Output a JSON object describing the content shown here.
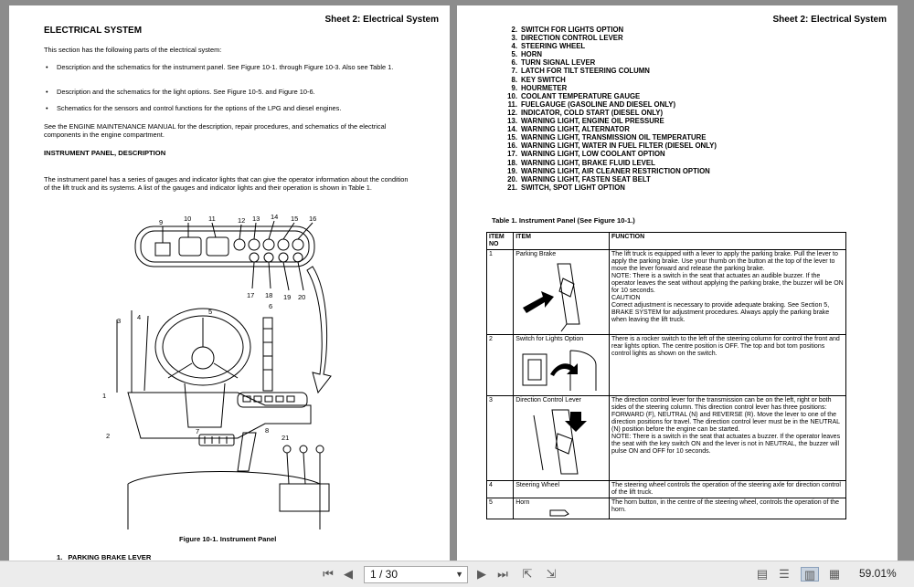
{
  "left_page": {
    "sheet_header": "Sheet 2: Electrical System",
    "title": "ELECTRICAL SYSTEM",
    "intro": "This section has the following parts of the electrical system:",
    "bullets": [
      "Description and the schematics for the instrument  panel.  See  Figure 10-1.  through Figure 10-3. Also see Table 1.",
      "Description and the schematics for the light options. See Figure 10-5. and Figure 10-6.",
      "Schematics for the sensors and control functions for the options of the LPG and diesel engines."
    ],
    "see_manual": "See the ENGINE MAINTENANCE MANUAL for the description, repair procedures, and schematics of the electrical components in the engine compartment.",
    "subheading": "INSTRUMENT PANEL, DESCRIPTION",
    "description": "The instrument panel has a series of gauges and indicator lights that can give the operator information about the condition of the lift truck and its systems. A list of the gauges and indicator lights and their operation is shown in Table 1.",
    "figure": {
      "labels_top": [
        "9",
        "10",
        "11",
        "12",
        "13",
        "14",
        "15",
        "16"
      ],
      "labels_bottom": [
        "17",
        "18",
        "19",
        "20"
      ],
      "labels_body": [
        "1",
        "2",
        "3",
        "4",
        "5",
        "6",
        "7",
        "8",
        "21"
      ],
      "caption": "Figure 10-1. Instrument Panel"
    },
    "bottom_heading_num": "1.",
    "bottom_heading": "PARKING BRAKE LEVER"
  },
  "right_page": {
    "sheet_header": "Sheet 2: Electrical System",
    "list": [
      {
        "n": "2.",
        "t": "SWITCH FOR LIGHTS OPTION"
      },
      {
        "n": "3.",
        "t": "DIRECTION CONTROL LEVER"
      },
      {
        "n": "4.",
        "t": "STEERING WHEEL"
      },
      {
        "n": "5.",
        "t": "HORN"
      },
      {
        "n": "6.",
        "t": "TURN SIGNAL LEVER"
      },
      {
        "n": "7.",
        "t": "LATCH FOR TILT STEERING COLUMN"
      },
      {
        "n": "8.",
        "t": "KEY SWITCH"
      },
      {
        "n": "9.",
        "t": "HOURMETER"
      },
      {
        "n": "10.",
        "t": "COOLANT TEMPERATURE GAUGE"
      },
      {
        "n": "11.",
        "t": "FUELGAUGE (GASOLINE AND DIESEL ONLY)"
      },
      {
        "n": "12.",
        "t": "INDICATOR, COLD START (DIESEL ONLY)"
      },
      {
        "n": "13.",
        "t": "WARNING LIGHT, ENGINE OIL PRESSURE"
      },
      {
        "n": "14.",
        "t": "WARNING LIGHT, ALTERNATOR"
      },
      {
        "n": "15.",
        "t": "WARNING LIGHT, TRANSMISSION OIL TEMPERATURE"
      },
      {
        "n": "16.",
        "t": "WARNING LIGHT, WATER IN FUEL FILTER (DIESEL ONLY)"
      },
      {
        "n": "17.",
        "t": "WARNING LIGHT, LOW COOLANT OPTION"
      },
      {
        "n": "18.",
        "t": "WARNING LIGHT, BRAKE FLUID LEVEL"
      },
      {
        "n": "19.",
        "t": "WARNING LIGHT, AIR CLEANER RESTRICTION OPTION"
      },
      {
        "n": "20.",
        "t": "WARNING LIGHT, FASTEN SEAT BELT"
      },
      {
        "n": "21.",
        "t": "SWITCH, SPOT LIGHT OPTION"
      }
    ],
    "table_caption": "Table 1. Instrument Panel (See Figure 10-1.)",
    "table": {
      "headers": [
        "ITEM NO",
        "ITEM",
        "FUNCTION"
      ],
      "rows": [
        {
          "no": "1",
          "item": "Parking Brake",
          "func": "The lift truck is equipped with a lever to apply the parking brake. Pull the lever to apply the parking brake. Use your thumb on the button at the top of the lever to move the lever forward and release the parking brake.\nNOTE: There is a switch in the seat that actuates an audible buzzer. If the operator leaves the seat without applying the parking brake, the buzzer will be ON for 10 seconds.\nCAUTION\nCorrect adjustment is necessary to provide adequate braking. See Section 5, BRAKE SYSTEM for adjustment procedures. Always apply the parking brake when leaving the lift truck."
        },
        {
          "no": "2",
          "item": "Switch for Lights Option",
          "func": "There is a rocker switch to the left of the steering column for control the front and rear lights option. The centre position is OFF. The top and bot tom positions control lights as shown on the switch."
        },
        {
          "no": "3",
          "item": "Direction Control Lever",
          "func": "The direction control lever for the transmission can be on the left, right or both sides of the steering column. This direction control lever has three positions: FORWARD (F), NEUTRAL (N) and REVERSE (R). Move the lever to one of the direction positions for travel. The direction control lever must be in the NEUTRAL (N) position before the engine can be started.\nNOTE: There is a switch in the seat that actuates a buzzer. If the operator leaves the seat with the key switch ON and the lever is not in NEUTRAL, the buzzer will pulse ON and OFF for 10 seconds."
        },
        {
          "no": "4",
          "item": "Steering Wheel",
          "func": "The steering wheel controls the operation of the steering axle for direction control of the lift truck."
        },
        {
          "no": "5",
          "item": "Horn",
          "func": "The horn button, in the centre of the steering wheel, controls the operation of the horn."
        }
      ]
    }
  },
  "toolbar": {
    "page_value": "1 / 30",
    "zoom": "59.01%"
  }
}
